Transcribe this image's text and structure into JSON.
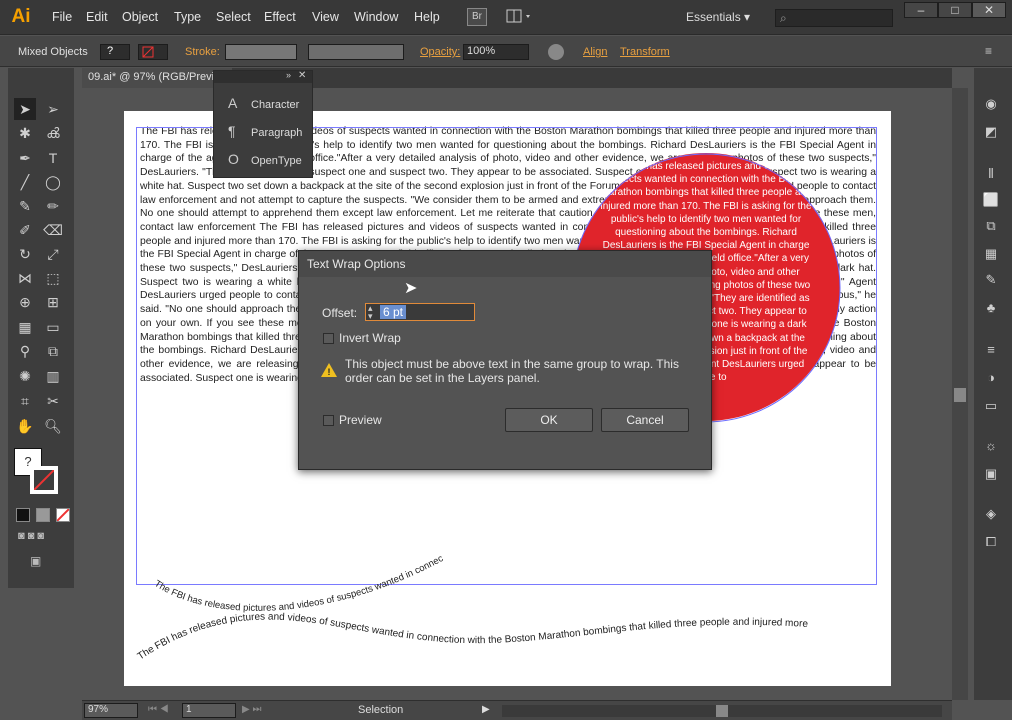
{
  "app": {
    "logo": "Ai"
  },
  "menu": [
    "File",
    "Edit",
    "Object",
    "Type",
    "Select",
    "Effect",
    "View",
    "Window",
    "Help"
  ],
  "topbar": {
    "bridge": "Br",
    "workspace": "Essentials",
    "search_placeholder": ""
  },
  "control": {
    "selection": "Mixed Objects",
    "stroke_label": "Stroke:",
    "opacity_label": "Opacity:",
    "opacity_value": "100%",
    "align": "Align",
    "transform": "Transform",
    "fill_unknown": "?"
  },
  "document": {
    "tab": "09.ai* @ 97% (RGB/Previ"
  },
  "char_panel": {
    "items": [
      "Character",
      "Paragraph",
      "OpenType"
    ],
    "glyphs": [
      "A",
      "¶",
      "O"
    ]
  },
  "body_text": "The FBI has released pictures and videos of suspects wanted in connection with the Boston Marathon bombings that killed three people and injured more than 170. The FBI is asking for the public's help to identify two men wanted for questioning about the bombings. Richard DesLauriers is the FBI Special Agent in charge of the agency's Boston field office.\"After a very detailed analysis of photo, video and other evidence, we are releasing photos of these two suspects,\" DesLauriers. \"They are identified as suspect one and suspect two. They appear to be associated. Suspect one is wearing a dark hat. Suspect two is wearing a white hat. Suspect two set down a backpack at the site of the second explosion just in front of the Forum restaurant.\" Agent DesLauriers urged people to contact law enforcement and not attempt to capture the suspects. \"We consider them to be armed and extremely dangerous,\" he said. \"No one should approach them. No one should attempt to apprehend them except law enforcement. Let me reiterate that caution. Do not take any action on your own. If you see these men, contact law enforcement The FBI has released pictures and videos of suspects wanted in connection with the Boston Marathon bombings that killed three people and injured more than 170. The FBI is asking for the public's help to identify two men wanted for questioning about the bombings. Richard DesLauriers is the FBI Special Agent in charge of the agency's Boston field office.\"After a very detailed analysis of photo, video and other evidence, we are releasing photos of these two suspects,\" DesLauriers. \"They are identified as suspect one and suspect two. They appear to be associated. Suspect one is wearing a dark hat. Suspect two is wearing a white hat. Suspect two set down a backpack at the site of the second explosion just in front of the Forum restaurant.\" Agent DesLauriers urged people to contact law enforcement and not attempt to capture the suspects. \"We consider them to be armed and extremely dangerous,\" he said. \"No one should approach them. No one should attempt to apprehend them except law enforcement. Let me reiterate that caution. Do not take any action on your own. If you see these men, contact law enforcement The FBI has released pictures and videos of suspects wanted in connection with the Boston Marathon bombings that killed three people and injured more than 170. The FBI is asking for the public's help to identify two men wanted for questioning about the bombings. Richard DesLauriers is the FBI Special Agent in charge of the agency's Boston field office.\"After a very detailed analysis of photo, video and other evidence, we are releasing photos of these two suspects,\" DesLauriers. \"They are identified as suspect one and suspect two. They appear to be associated. Suspect one is wearing a dark hat. Suspect two is wearing a white hat. Suspect two se",
  "circle_text": "The FBI has released pictures and videos of suspects wanted in connection with the Boston Marathon bombings that killed three people and injured more than 170. The FBI is asking for the public's help to identify two men wanted for questioning about the bombings. Richard DesLauriers is the FBI Special Agent in charge of the agency's Boston field office.\"After a very detailed analysis of photo, video and other evidence, we are releasing photos of these two suspects,\" DesLauriers. \"They are identified as suspect one and suspect two. They appear to be associated. Suspect one is wearing a dark hat. Suspect two set down a backpack at the site of the second explosion just in front of the Forum restaurant.\" Agent DesLauriers urged people to",
  "path_text_wave": "The FBI has released pictures and videos of suspects wanted in connection with the Boston Marathon bombings that killed three people and injured more",
  "path_text_arc": "The FBI has released pictures and videos of suspects wanted in connection with the Boston Marathon bombings that killed",
  "dialog": {
    "title": "Text Wrap Options",
    "offset_label": "Offset:",
    "offset_value": "6 pt",
    "invert_label": "Invert Wrap",
    "warning": "This object must be above text in the same group to wrap. This order can be set in the Layers panel.",
    "preview_label": "Preview",
    "ok": "OK",
    "cancel": "Cancel"
  },
  "status": {
    "zoom": "97%",
    "page": "1",
    "tool": "Selection"
  },
  "colors": {
    "accent": "#e8a040",
    "wrap_red": "#e0242b",
    "ai_orange": "#f5a000"
  }
}
